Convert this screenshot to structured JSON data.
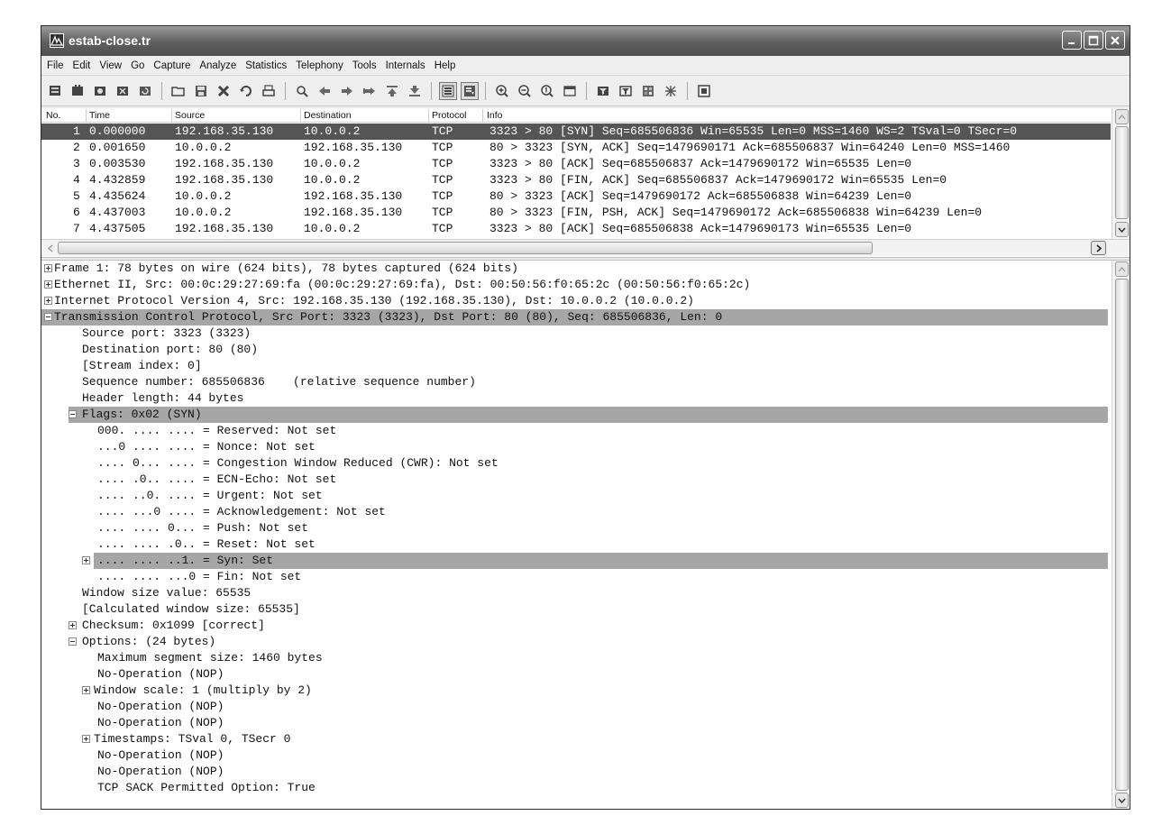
{
  "window": {
    "title": "estab-close.tr"
  },
  "menu": [
    "File",
    "Edit",
    "View",
    "Go",
    "Capture",
    "Analyze",
    "Statistics",
    "Telephony",
    "Tools",
    "Internals",
    "Help"
  ],
  "toolbar_icons": [
    "interface-list-icon",
    "capture-options-icon",
    "start-capture-icon",
    "stop-capture-icon",
    "restart-capture-icon",
    "open-file-icon",
    "save-file-icon",
    "close-file-icon",
    "reload-file-icon",
    "print-icon",
    "find-packet-icon",
    "go-back-icon",
    "go-forward-icon",
    "go-to-packet-icon",
    "go-first-icon",
    "go-last-icon",
    "colorize-icon",
    "auto-scroll-icon",
    "zoom-in-icon",
    "zoom-out-icon",
    "zoom-normal-icon",
    "resize-columns-icon",
    "capture-filters-icon",
    "display-filters-icon",
    "coloring-rules-icon",
    "preferences-icon",
    "help-icon"
  ],
  "packet_list": {
    "columns": [
      "No.",
      "Time",
      "Source",
      "Destination",
      "Protocol",
      "Info"
    ],
    "rows": [
      {
        "no": "1",
        "time": "0.000000",
        "source": "192.168.35.130",
        "destination": "10.0.0.2",
        "protocol": "TCP",
        "info": "3323 > 80 [SYN] Seq=685506836 Win=65535 Len=0 MSS=1460 WS=2 TSval=0 TSecr=0"
      },
      {
        "no": "2",
        "time": "0.001650",
        "source": "10.0.0.2",
        "destination": "192.168.35.130",
        "protocol": "TCP",
        "info": "80 > 3323 [SYN, ACK] Seq=1479690171 Ack=685506837 Win=64240 Len=0 MSS=1460"
      },
      {
        "no": "3",
        "time": "0.003530",
        "source": "192.168.35.130",
        "destination": "10.0.0.2",
        "protocol": "TCP",
        "info": "3323 > 80 [ACK] Seq=685506837 Ack=1479690172 Win=65535 Len=0"
      },
      {
        "no": "4",
        "time": "4.432859",
        "source": "192.168.35.130",
        "destination": "10.0.0.2",
        "protocol": "TCP",
        "info": "3323 > 80 [FIN, ACK] Seq=685506837 Ack=1479690172 Win=65535 Len=0"
      },
      {
        "no": "5",
        "time": "4.435624",
        "source": "10.0.0.2",
        "destination": "192.168.35.130",
        "protocol": "TCP",
        "info": "80 > 3323 [ACK] Seq=1479690172 Ack=685506838 Win=64239 Len=0"
      },
      {
        "no": "6",
        "time": "4.437003",
        "source": "10.0.0.2",
        "destination": "192.168.35.130",
        "protocol": "TCP",
        "info": "80 > 3323 [FIN, PSH, ACK] Seq=1479690172 Ack=685506838 Win=64239 Len=0"
      },
      {
        "no": "7",
        "time": "4.437505",
        "source": "192.168.35.130",
        "destination": "10.0.0.2",
        "protocol": "TCP",
        "info": "3323 > 80 [ACK] Seq=685506838 Ack=1479690173 Win=65535 Len=0"
      }
    ]
  },
  "details": [
    {
      "text": "Frame 1: 78 bytes on wire (624 bits), 78 bytes captured (624 bits)",
      "toggle": "collapsed"
    },
    {
      "text": "Ethernet II, Src: 00:0c:29:27:69:fa (00:0c:29:27:69:fa), Dst: 00:50:56:f0:65:2c (00:50:56:f0:65:2c)",
      "toggle": "collapsed"
    },
    {
      "text": "Internet Protocol Version 4, Src: 192.168.35.130 (192.168.35.130), Dst: 10.0.0.2 (10.0.0.2)",
      "toggle": "collapsed"
    },
    {
      "text": "Transmission Control Protocol, Src Port: 3323 (3323), Dst Port: 80 (80), Seq: 685506836, Len: 0",
      "toggle": "expanded",
      "highlight": true
    },
    {
      "text": "Source port: 3323 (3323)"
    },
    {
      "text": "Destination port: 80 (80)"
    },
    {
      "text": "[Stream index: 0]"
    },
    {
      "text": "Sequence number: 685506836    (relative sequence number)"
    },
    {
      "text": "Header length: 44 bytes"
    },
    {
      "text": "Flags: 0x02 (SYN)",
      "toggle": "expanded",
      "highlight": true
    },
    {
      "text": "000. .... .... = Reserved: Not set"
    },
    {
      "text": "...0 .... .... = Nonce: Not set"
    },
    {
      "text": ".... 0... .... = Congestion Window Reduced (CWR): Not set"
    },
    {
      "text": ".... .0.. .... = ECN-Echo: Not set"
    },
    {
      "text": ".... ..0. .... = Urgent: Not set"
    },
    {
      "text": ".... ...0 .... = Acknowledgement: Not set"
    },
    {
      "text": ".... .... 0... = Push: Not set"
    },
    {
      "text": ".... .... .0.. = Reset: Not set"
    },
    {
      "text": ".... .... ..1. = Syn: Set",
      "toggle": "collapsed",
      "highlight": true
    },
    {
      "text": ".... .... ...0 = Fin: Not set"
    },
    {
      "text": "Window size value: 65535"
    },
    {
      "text": "[Calculated window size: 65535]"
    },
    {
      "text": "Checksum: 0x1099 [correct]",
      "toggle": "collapsed"
    },
    {
      "text": "Options: (24 bytes)",
      "toggle": "expanded"
    },
    {
      "text": "Maximum segment size: 1460 bytes"
    },
    {
      "text": "No-Operation (NOP)"
    },
    {
      "text": "Window scale: 1 (multiply by 2)",
      "toggle": "collapsed"
    },
    {
      "text": "No-Operation (NOP)"
    },
    {
      "text": "No-Operation (NOP)"
    },
    {
      "text": "Timestamps: TSval 0, TSecr 0",
      "toggle": "collapsed"
    },
    {
      "text": "No-Operation (NOP)"
    },
    {
      "text": "No-Operation (NOP)"
    },
    {
      "text": "TCP SACK Permitted Option: True"
    }
  ]
}
